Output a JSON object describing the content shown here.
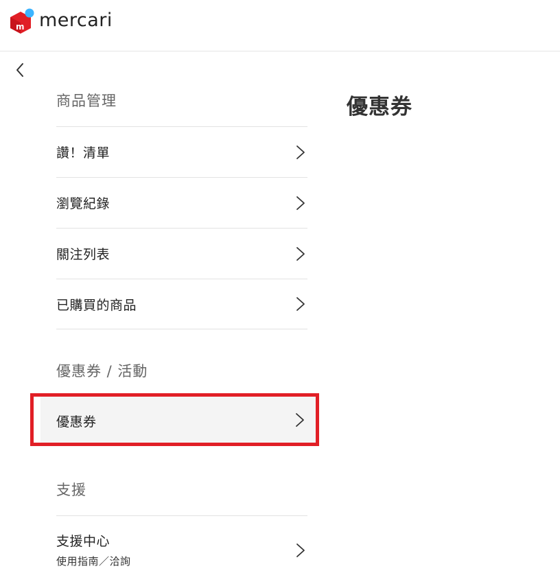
{
  "header": {
    "logo_text": "mercari",
    "brand_colors": {
      "red": "#e11f26",
      "blue": "#3cb4ff"
    }
  },
  "nav": {
    "back_icon": "chevron-left-icon"
  },
  "sidebar": {
    "sections": [
      {
        "title": "商品管理",
        "items": [
          {
            "label": "讚！清單"
          },
          {
            "label": "瀏覽紀錄"
          },
          {
            "label": "關注列表"
          },
          {
            "label": "已購買的商品"
          }
        ]
      },
      {
        "title": "優惠券 / 活動",
        "items": [
          {
            "label": "優惠券",
            "selected": true
          }
        ]
      },
      {
        "title": "支援",
        "items": [
          {
            "label": "支援中心",
            "sublabel": "使用指南／洽詢"
          }
        ]
      }
    ]
  },
  "main": {
    "title": "優惠券"
  },
  "colors": {
    "highlight_border": "#e11f26",
    "selected_bg": "#f4f4f4",
    "divider": "#e2e2e2",
    "section_title": "#666666"
  }
}
